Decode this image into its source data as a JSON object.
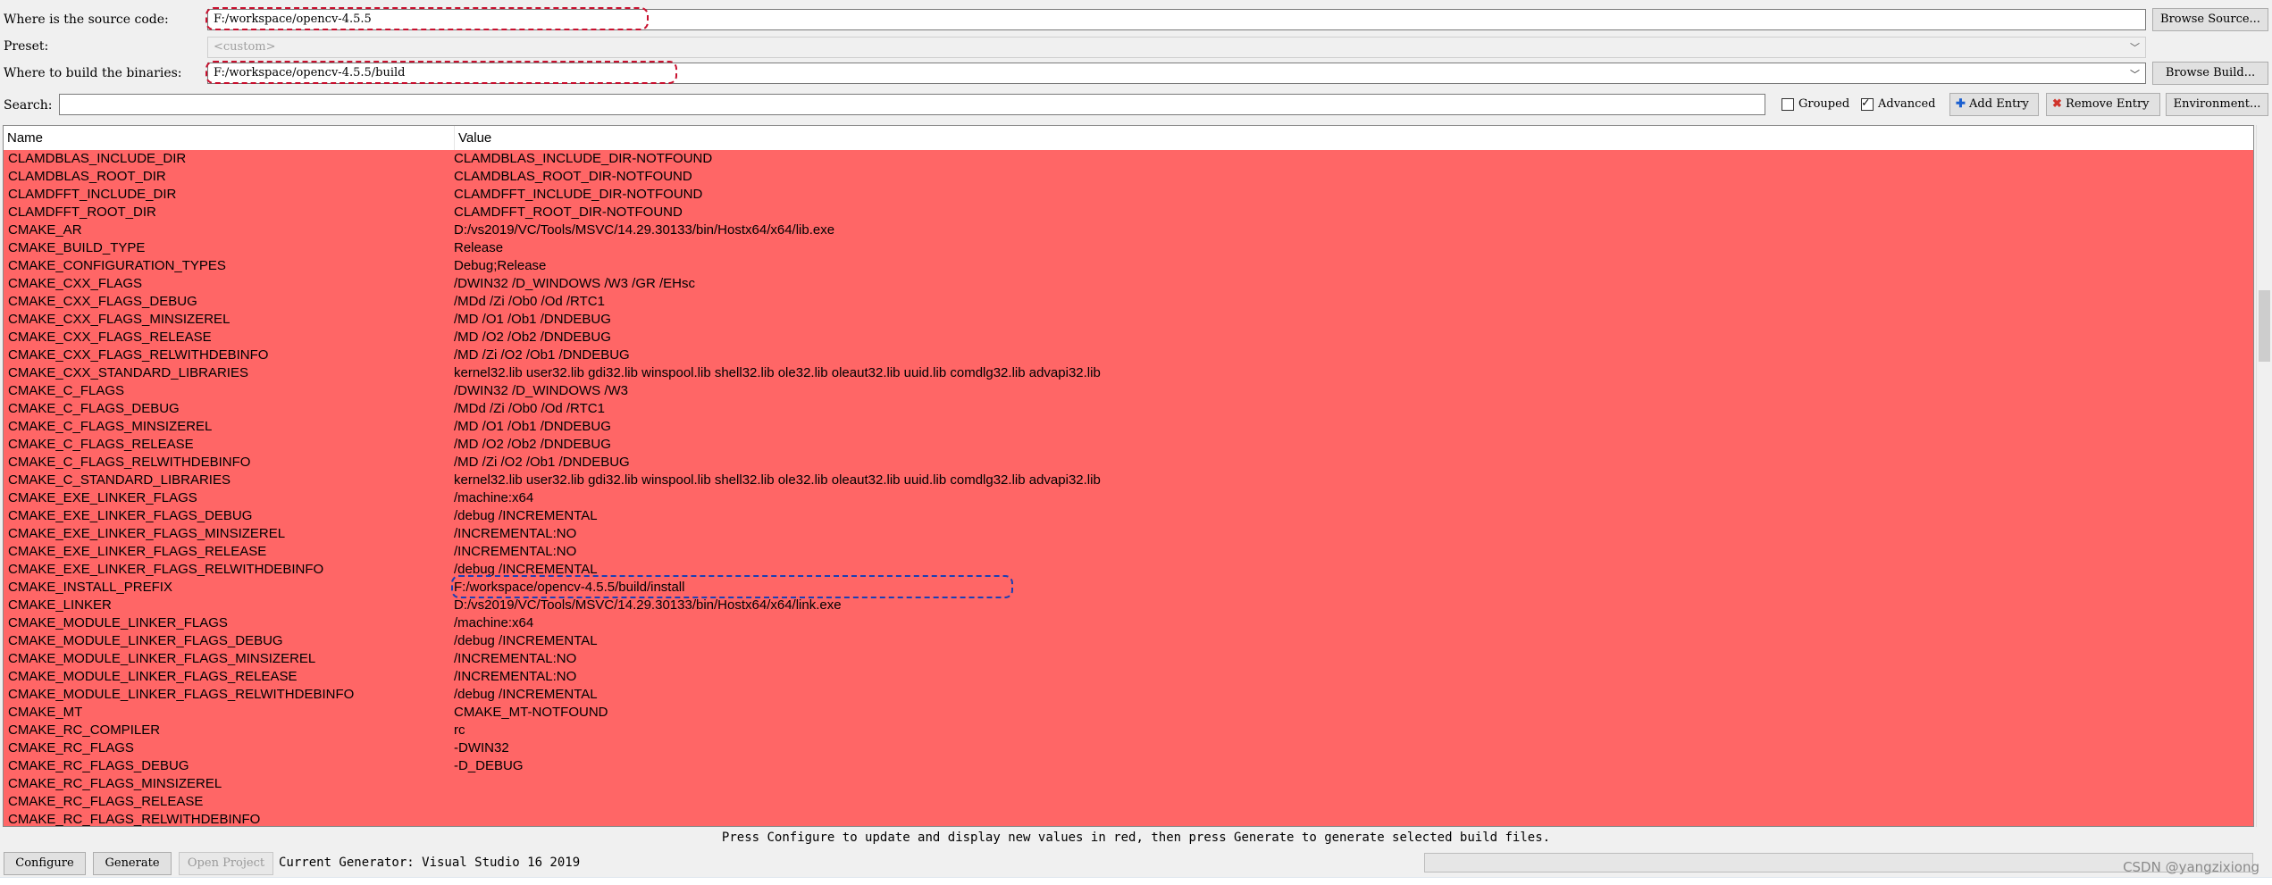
{
  "source": {
    "label": "Where is the source code:",
    "value": "F:/workspace/opencv-4.5.5",
    "browse_label": "Browse Source..."
  },
  "preset": {
    "label": "Preset:",
    "value": "<custom>"
  },
  "build": {
    "label": "Where to build the binaries:",
    "value": "F:/workspace/opencv-4.5.5/build",
    "browse_label": "Browse Build..."
  },
  "search": {
    "label": "Search:",
    "value": ""
  },
  "options": {
    "grouped_label": "Grouped",
    "grouped_checked": false,
    "advanced_label": "Advanced",
    "advanced_checked": true,
    "add_entry_label": "Add Entry",
    "remove_entry_label": "Remove Entry",
    "environment_label": "Environment..."
  },
  "table": {
    "columns": [
      "Name",
      "Value"
    ],
    "row_color": "#ff6666",
    "rows": [
      {
        "name": "CLAMDBLAS_INCLUDE_DIR",
        "value": "CLAMDBLAS_INCLUDE_DIR-NOTFOUND"
      },
      {
        "name": "CLAMDBLAS_ROOT_DIR",
        "value": "CLAMDBLAS_ROOT_DIR-NOTFOUND"
      },
      {
        "name": "CLAMDFFT_INCLUDE_DIR",
        "value": "CLAMDFFT_INCLUDE_DIR-NOTFOUND"
      },
      {
        "name": "CLAMDFFT_ROOT_DIR",
        "value": "CLAMDFFT_ROOT_DIR-NOTFOUND"
      },
      {
        "name": "CMAKE_AR",
        "value": "D:/vs2019/VC/Tools/MSVC/14.29.30133/bin/Hostx64/x64/lib.exe"
      },
      {
        "name": "CMAKE_BUILD_TYPE",
        "value": "Release"
      },
      {
        "name": "CMAKE_CONFIGURATION_TYPES",
        "value": "Debug;Release"
      },
      {
        "name": "CMAKE_CXX_FLAGS",
        "value": "/DWIN32 /D_WINDOWS /W3 /GR /EHsc"
      },
      {
        "name": "CMAKE_CXX_FLAGS_DEBUG",
        "value": "/MDd /Zi /Ob0 /Od /RTC1"
      },
      {
        "name": "CMAKE_CXX_FLAGS_MINSIZEREL",
        "value": "/MD /O1 /Ob1 /DNDEBUG"
      },
      {
        "name": "CMAKE_CXX_FLAGS_RELEASE",
        "value": "/MD /O2 /Ob2 /DNDEBUG"
      },
      {
        "name": "CMAKE_CXX_FLAGS_RELWITHDEBINFO",
        "value": "/MD /Zi /O2 /Ob1 /DNDEBUG"
      },
      {
        "name": "CMAKE_CXX_STANDARD_LIBRARIES",
        "value": "kernel32.lib user32.lib gdi32.lib winspool.lib shell32.lib ole32.lib oleaut32.lib uuid.lib comdlg32.lib advapi32.lib"
      },
      {
        "name": "CMAKE_C_FLAGS",
        "value": "/DWIN32 /D_WINDOWS /W3"
      },
      {
        "name": "CMAKE_C_FLAGS_DEBUG",
        "value": "/MDd /Zi /Ob0 /Od /RTC1"
      },
      {
        "name": "CMAKE_C_FLAGS_MINSIZEREL",
        "value": "/MD /O1 /Ob1 /DNDEBUG"
      },
      {
        "name": "CMAKE_C_FLAGS_RELEASE",
        "value": "/MD /O2 /Ob2 /DNDEBUG"
      },
      {
        "name": "CMAKE_C_FLAGS_RELWITHDEBINFO",
        "value": "/MD /Zi /O2 /Ob1 /DNDEBUG"
      },
      {
        "name": "CMAKE_C_STANDARD_LIBRARIES",
        "value": "kernel32.lib user32.lib gdi32.lib winspool.lib shell32.lib ole32.lib oleaut32.lib uuid.lib comdlg32.lib advapi32.lib"
      },
      {
        "name": "CMAKE_EXE_LINKER_FLAGS",
        "value": "/machine:x64"
      },
      {
        "name": "CMAKE_EXE_LINKER_FLAGS_DEBUG",
        "value": "/debug /INCREMENTAL"
      },
      {
        "name": "CMAKE_EXE_LINKER_FLAGS_MINSIZEREL",
        "value": "/INCREMENTAL:NO"
      },
      {
        "name": "CMAKE_EXE_LINKER_FLAGS_RELEASE",
        "value": "/INCREMENTAL:NO"
      },
      {
        "name": "CMAKE_EXE_LINKER_FLAGS_RELWITHDEBINFO",
        "value": "/debug /INCREMENTAL"
      },
      {
        "name": "CMAKE_INSTALL_PREFIX",
        "value": "F:/workspace/opencv-4.5.5/build/install"
      },
      {
        "name": "CMAKE_LINKER",
        "value": "D:/vs2019/VC/Tools/MSVC/14.29.30133/bin/Hostx64/x64/link.exe"
      },
      {
        "name": "CMAKE_MODULE_LINKER_FLAGS",
        "value": "/machine:x64"
      },
      {
        "name": "CMAKE_MODULE_LINKER_FLAGS_DEBUG",
        "value": "/debug /INCREMENTAL"
      },
      {
        "name": "CMAKE_MODULE_LINKER_FLAGS_MINSIZEREL",
        "value": "/INCREMENTAL:NO"
      },
      {
        "name": "CMAKE_MODULE_LINKER_FLAGS_RELEASE",
        "value": "/INCREMENTAL:NO"
      },
      {
        "name": "CMAKE_MODULE_LINKER_FLAGS_RELWITHDEBINFO",
        "value": "/debug /INCREMENTAL"
      },
      {
        "name": "CMAKE_MT",
        "value": "CMAKE_MT-NOTFOUND"
      },
      {
        "name": "CMAKE_RC_COMPILER",
        "value": "rc"
      },
      {
        "name": "CMAKE_RC_FLAGS",
        "value": "-DWIN32"
      },
      {
        "name": "CMAKE_RC_FLAGS_DEBUG",
        "value": "-D_DEBUG"
      },
      {
        "name": "CMAKE_RC_FLAGS_MINSIZEREL",
        "value": ""
      },
      {
        "name": "CMAKE_RC_FLAGS_RELEASE",
        "value": ""
      },
      {
        "name": "CMAKE_RC_FLAGS_RELWITHDEBINFO",
        "value": ""
      }
    ]
  },
  "hint": "Press Configure to update and display new values in red, then press Generate to generate selected build files.",
  "footer": {
    "configure_label": "Configure",
    "generate_label": "Generate",
    "open_project_label": "Open Project",
    "generator_text": "Current Generator: Visual Studio 16 2019"
  },
  "watermark": "CSDN @yangzixiong"
}
